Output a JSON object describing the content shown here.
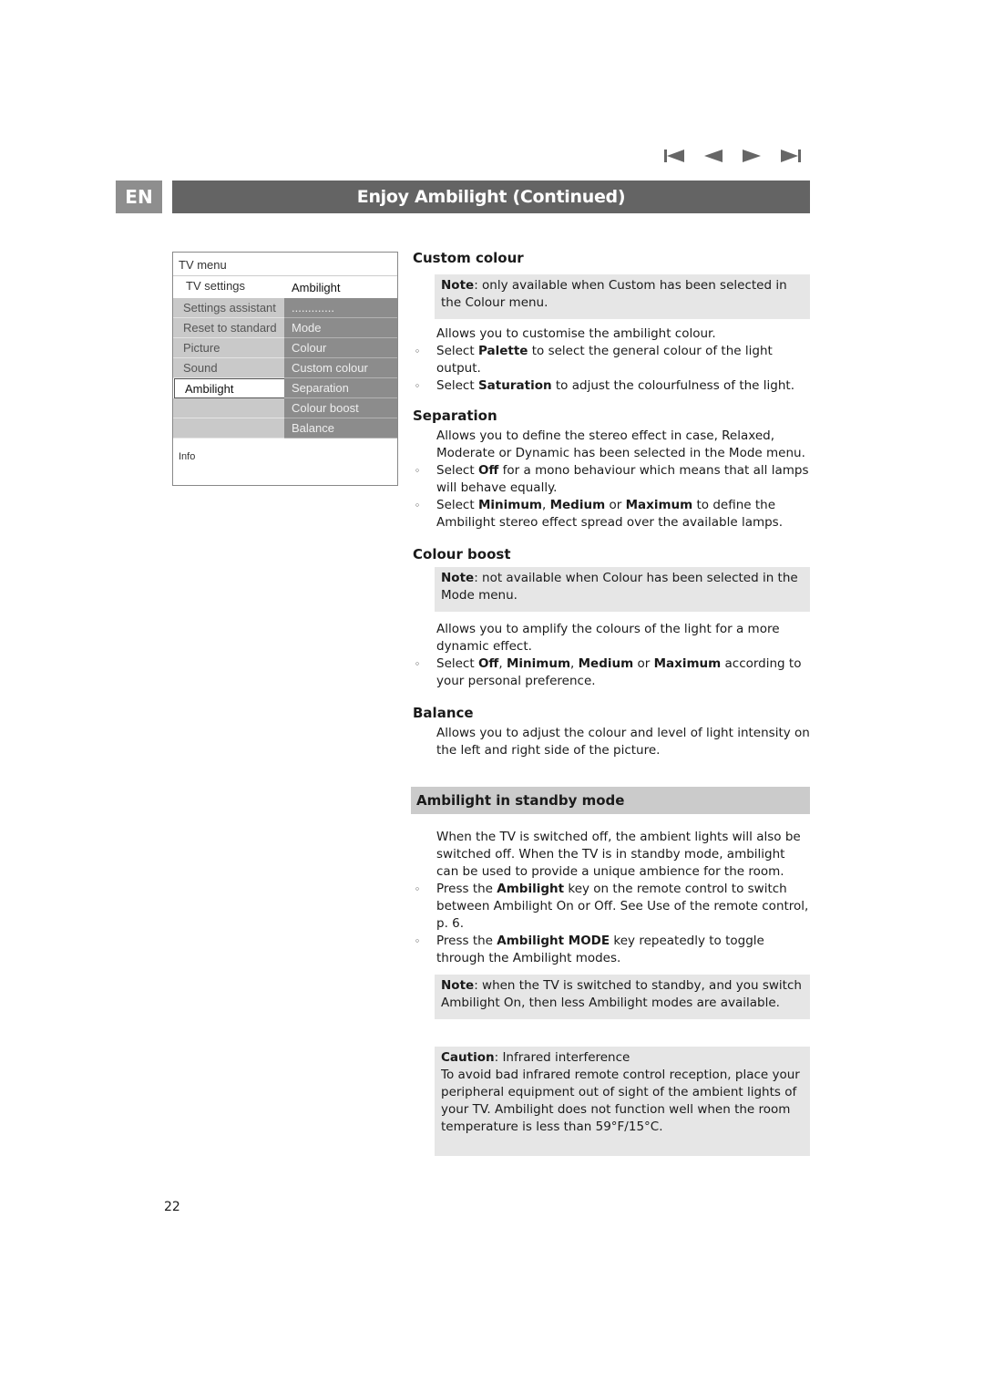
{
  "nav": {
    "first_icon": "skip-to-first-icon",
    "prev_icon": "previous-icon",
    "next_icon": "next-icon",
    "last_icon": "skip-to-last-icon"
  },
  "header": {
    "language_badge": "EN",
    "title": "Enjoy Ambilight  (Continued)"
  },
  "tv_menu": {
    "title": "TV menu",
    "left_header": "TV settings",
    "right_header": "Ambilight",
    "left_items": [
      {
        "label": "Settings assistant"
      },
      {
        "label": "Reset to standard"
      },
      {
        "label": "Picture"
      },
      {
        "label": "Sound"
      },
      {
        "label": "Ambilight",
        "selected": true
      },
      {
        "label": ""
      },
      {
        "label": ""
      }
    ],
    "right_items": [
      {
        "label": "............."
      },
      {
        "label": "Mode"
      },
      {
        "label": "Colour"
      },
      {
        "label": "Custom colour"
      },
      {
        "label": "Separation"
      },
      {
        "label": "Colour boost"
      },
      {
        "label": "Balance"
      }
    ],
    "info_label": "Info"
  },
  "sections": {
    "custom_colour": {
      "heading": "Custom colour",
      "note_label": "Note",
      "note_text": ": only available when Custom has been selected in the Colour menu.",
      "intro": "Allows you to customise the ambilight colour.",
      "b1_pre": "Select ",
      "b1_bold": "Palette",
      "b1_post": " to select the general colour of the light output.",
      "b2_pre": "Select ",
      "b2_bold": "Saturation",
      "b2_post": " to adjust the colourfulness of the light."
    },
    "separation": {
      "heading": "Separation",
      "intro": "Allows you to define the stereo effect in case, Relaxed, Moderate or Dynamic has been selected in the Mode menu.",
      "b1_pre": "Select ",
      "b1_bold": "Off",
      "b1_post": " for a mono behaviour which means that all lamps will behave equally.",
      "b2_pre": "Select ",
      "b2_bold1": "Minimum",
      "b2_sep1": ", ",
      "b2_bold2": "Medium",
      "b2_sep2": " or ",
      "b2_bold3": "Maximum",
      "b2_post": " to define the Ambilight stereo effect spread over the available lamps."
    },
    "colour_boost": {
      "heading": "Colour boost",
      "note_label": "Note",
      "note_text": ": not available when Colour has been selected in the Mode menu.",
      "intro": "Allows you to amplify the colours of the light for a more dynamic effect.",
      "b1_pre": "Select ",
      "b1_bold1": "Off",
      "b1_sep1": ", ",
      "b1_bold2": "Minimum",
      "b1_sep2": ", ",
      "b1_bold3": "Medium",
      "b1_sep3": " or ",
      "b1_bold4": "Maximum",
      "b1_post": " according to your personal preference."
    },
    "balance": {
      "heading": "Balance",
      "intro": "Allows you to adjust the colour and level of light intensity on the left and right side of the picture."
    },
    "standby": {
      "heading": "Ambilight in standby mode",
      "intro": "When the TV is switched off, the ambient lights will also be switched off. When the TV is in standby mode, ambilight can be used to provide a unique ambience for the room.",
      "b1_pre": "Press the ",
      "b1_bold": "Ambilight",
      "b1_post": " key on the remote control to switch between Ambilight On or Off. See Use of the remote control, p. 6.",
      "b2_pre": "Press the ",
      "b2_bold": "Ambilight MODE",
      "b2_post": " key repeatedly to toggle through the Ambilight modes.",
      "note_label": "Note",
      "note_text": ": when the TV is switched to standby, and you switch Ambilight On, then less Ambilight modes are available.",
      "caution_label": "Caution",
      "caution_title": ": Infrared interference",
      "caution_text": "To avoid bad infrared remote control reception, place your peripheral equipment out of sight of the ambient lights of your TV. Ambilight does not  function well when the room temperature is less than 59°F/15°C."
    }
  },
  "bullet_glyph": "◦",
  "page_number": "22"
}
